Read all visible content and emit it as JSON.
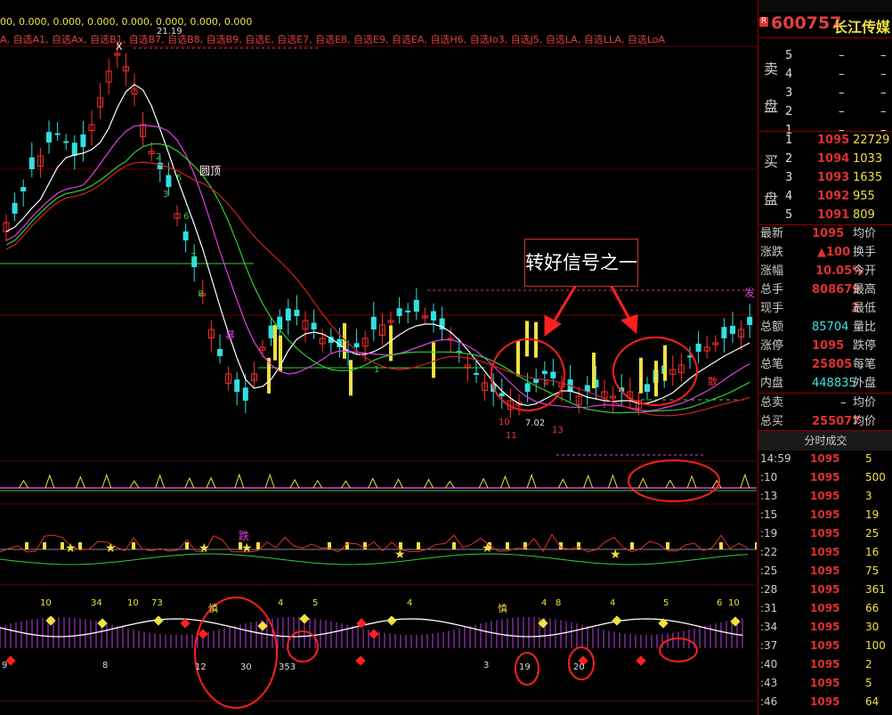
{
  "indicator_bar": {
    "values": "00, 0.000, 0.000, 0.000, 0.000, 0.000, 0.000, 0.000",
    "selections": "A, 自选A1, 自选Ax, 自选B1, 自选B7, 自选B8, 自选B9, 自选E, 自选E7, 自选E8, 自选E9, 自选EA, 自选H6, 自选Io3, 自选J5, 自选LA, 自选LLA, 自选LoA"
  },
  "chart_labels": {
    "high_label": "21.19",
    "low_label": "7.02",
    "pattern_label": "圆顶",
    "signal_1": "发",
    "signal_2": "散",
    "signal_3": "暴",
    "signal_4": "慎",
    "signal_5": "慎",
    "signal_6": "跌",
    "x_mark": "X",
    "counts": [
      "10",
      "11",
      "13",
      "4",
      "5",
      "6",
      "7",
      "8",
      "3",
      "2",
      "1"
    ]
  },
  "callout": {
    "text": "转好信号之一"
  },
  "lower_panel_numbers": [
    "10",
    "34",
    "10",
    "73",
    "4",
    "5",
    "4",
    "4",
    "8",
    "4",
    "5",
    "6",
    "10",
    "9",
    "8",
    "12",
    "30",
    "353",
    "3",
    "19",
    "20"
  ],
  "quote": {
    "code": "600757",
    "name": "长江传媒",
    "sell_side_label": [
      "卖",
      "盘"
    ],
    "buy_side_label": [
      "买",
      "盘"
    ],
    "sell": [
      {
        "level": "5",
        "price": "–",
        "vol": "–"
      },
      {
        "level": "4",
        "price": "–",
        "vol": "–"
      },
      {
        "level": "3",
        "price": "–",
        "vol": "–"
      },
      {
        "level": "2",
        "price": "–",
        "vol": "–"
      },
      {
        "level": "1",
        "price": "–",
        "vol": "–"
      }
    ],
    "buy": [
      {
        "level": "1",
        "price": "1095",
        "vol": "22729"
      },
      {
        "level": "2",
        "price": "1094",
        "vol": "1033"
      },
      {
        "level": "3",
        "price": "1093",
        "vol": "1635"
      },
      {
        "level": "4",
        "price": "1092",
        "vol": "955"
      },
      {
        "level": "5",
        "price": "1091",
        "vol": "809"
      }
    ],
    "stats": [
      {
        "l": "最新",
        "v": "1095",
        "r": "均价"
      },
      {
        "l": "涨跌",
        "v": "▲100",
        "r": "换手"
      },
      {
        "l": "涨幅",
        "v": "10.05%",
        "r": "今开"
      },
      {
        "l": "总手",
        "v": "808679",
        "r": "最高"
      },
      {
        "l": "现手",
        "v": "2",
        "r": "最低"
      },
      {
        "l": "总额",
        "v": "85704",
        "r": "量比"
      },
      {
        "l": "涨停",
        "v": "1095",
        "r": "跌停"
      },
      {
        "l": "总笔",
        "v": "25805",
        "r": "每笔"
      },
      {
        "l": "内盘",
        "v": "448835",
        "r": "外盘"
      },
      {
        "l": "总卖",
        "v": "–",
        "r": "均价"
      },
      {
        "l": "总买",
        "v": "255077",
        "r": "均价"
      }
    ],
    "ticker_title": "分时成交",
    "ticks": [
      {
        "t": "14:59",
        "p": "1095",
        "v": "5"
      },
      {
        "t": ":10",
        "p": "1095",
        "v": "500"
      },
      {
        "t": ":13",
        "p": "1095",
        "v": "3"
      },
      {
        "t": ":15",
        "p": "1095",
        "v": "19"
      },
      {
        "t": ":19",
        "p": "1095",
        "v": "25"
      },
      {
        "t": ":22",
        "p": "1095",
        "v": "16"
      },
      {
        "t": ":25",
        "p": "1095",
        "v": "75"
      },
      {
        "t": ":28",
        "p": "1095",
        "v": "361"
      },
      {
        "t": ":31",
        "p": "1095",
        "v": "66"
      },
      {
        "t": ":34",
        "p": "1095",
        "v": "30"
      },
      {
        "t": ":37",
        "p": "1095",
        "v": "100"
      },
      {
        "t": ":40",
        "p": "1095",
        "v": "2"
      },
      {
        "t": ":43",
        "p": "1095",
        "v": "5"
      },
      {
        "t": ":46",
        "p": "1095",
        "v": "64"
      }
    ]
  },
  "colors": {
    "up": "#ff3030",
    "down": "#30e0e0",
    "ma1": "#ffffff",
    "ma2": "#e040e0",
    "ma3": "#30d030",
    "ma4": "#d02020",
    "accent": "#f0e040"
  }
}
